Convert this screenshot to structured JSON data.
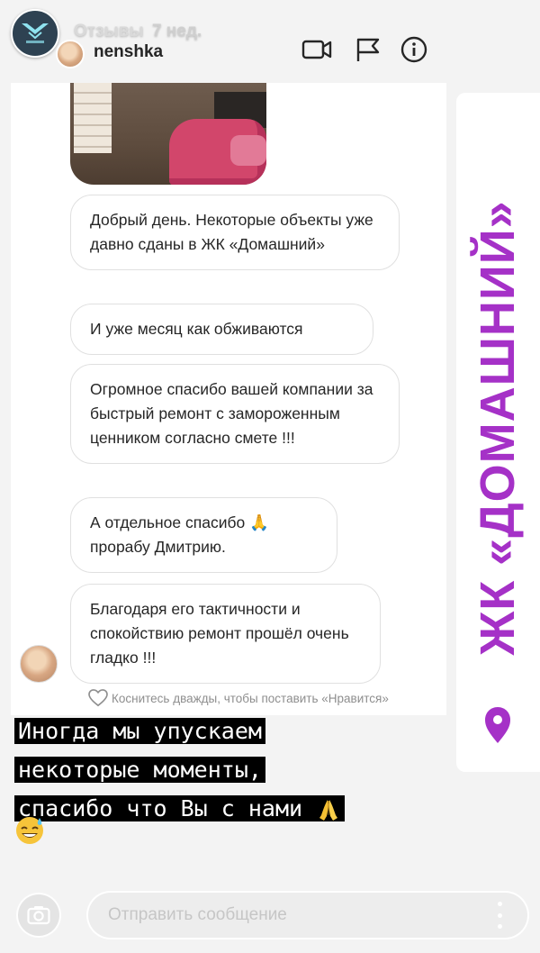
{
  "story_header": {
    "account_label": "Отзывы",
    "time_ago": "7 нед.",
    "post_username": "nenshka",
    "icons": [
      "video-call-icon",
      "flag-icon",
      "info-icon"
    ]
  },
  "dm": {
    "messages": [
      "Добрый день. Некоторые объекты уже давно сданы в ЖК «Домашний»",
      "И уже месяц как обживаются",
      "Огромное спасибо вашей компании за быстрый ремонт с замороженным ценником согласно смете !!!",
      "А отдельное спасибо 🙏 прорабу Дмитрию.",
      "Благодаря его тактичности и спокойствию ремонт прошёл очень гладко !!!"
    ],
    "like_hint": "Коснитесь дважды, чтобы поставить «Нравится»"
  },
  "caption": {
    "lines": [
      "Иногда мы упускаем",
      "некоторые моменты,",
      "спасибо что Вы с нами"
    ],
    "emojis": [
      "praying-hands-emoji",
      "sweat-smile-emoji"
    ]
  },
  "side_banner": {
    "text": "ЖК «ДОМАШНИЙ»",
    "color": "#a531c7",
    "icon": "location-pin-icon"
  },
  "reply_bar": {
    "placeholder": "Отправить сообщение",
    "icons": [
      "camera-icon",
      "more-icon"
    ]
  }
}
